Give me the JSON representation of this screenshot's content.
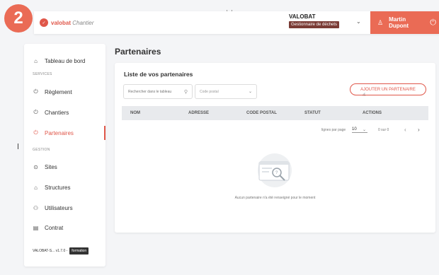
{
  "step": {
    "number": "2"
  },
  "header": {
    "logo_brand": "valobat",
    "logo_suffix": "Chantier",
    "company": "VALOBAT",
    "role": "Gestionnaire de déchets",
    "user_name": "Martin Dupont"
  },
  "sidebar": {
    "items": [
      {
        "label": "Tableau de bord",
        "icon": "home-icon"
      },
      {
        "label": "Règlement",
        "icon": "payment-icon"
      },
      {
        "label": "Chantiers",
        "icon": "site-icon"
      },
      {
        "label": "Partenaires",
        "icon": "partners-icon",
        "active": true
      },
      {
        "label": "Sites",
        "icon": "location-icon"
      },
      {
        "label": "Structures",
        "icon": "building-icon"
      },
      {
        "label": "Utilisateurs",
        "icon": "users-icon"
      },
      {
        "label": "Contrat",
        "icon": "contract-icon"
      }
    ],
    "section_services": "SERVICES",
    "section_gestion": "GESTION",
    "version": "VALOBAT-S... v1.7.0 -",
    "version_badge": "formation"
  },
  "main": {
    "page_title": "Partenaires",
    "card_title": "Liste de vos partenaires",
    "search_placeholder": "Rechercher dans le tableau",
    "postal_placeholder": "Code postal",
    "add_button": "AJOUTER UN PARTENAIRE",
    "columns": [
      "NOM",
      "ADRESSE",
      "CODE POSTAL",
      "STATUT",
      "ACTIONS"
    ],
    "rows_per_page_label": "lignes par page",
    "rows_per_page": "10",
    "range": "0 sur 0",
    "empty_message": "Aucun partenaire n'a été renseigné pour le moment"
  },
  "colors": {
    "accent": "#e0574a",
    "badge": "#ea6b55",
    "role_bg": "#7a3b35"
  }
}
